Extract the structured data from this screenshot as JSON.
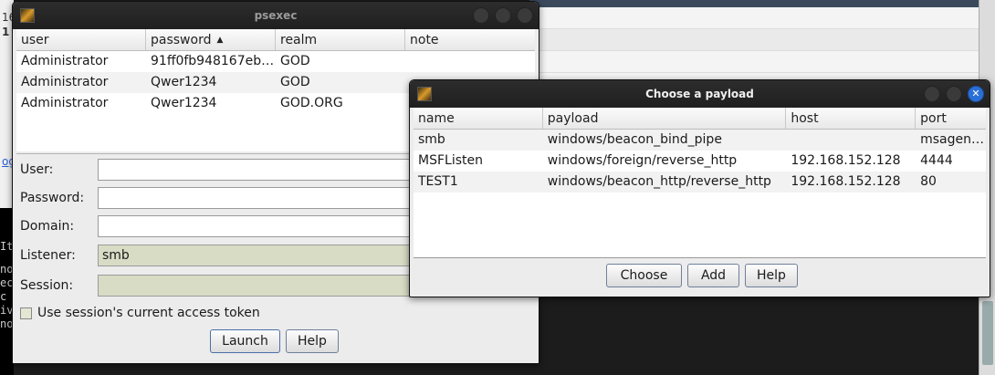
{
  "background": {
    "left_fragments": [
      "16",
      "1",
      "og"
    ],
    "terminal_lines": [
      "It",
      "",
      "no",
      "ec",
      "c",
      "iv",
      "no"
    ]
  },
  "psexec": {
    "title": "psexec",
    "columns": [
      "user",
      "password",
      "realm",
      "note"
    ],
    "sort_indicator": "▲",
    "rows": [
      [
        "Administrator",
        "91ff0fb948167eb…",
        "GOD",
        ""
      ],
      [
        "Administrator",
        "Qwer1234",
        "GOD",
        ""
      ],
      [
        "Administrator",
        "Qwer1234",
        "GOD.ORG",
        ""
      ]
    ],
    "form": {
      "user_label": "User:",
      "password_label": "Password:",
      "domain_label": "Domain:",
      "listener_label": "Listener:",
      "listener_value": "smb",
      "session_label": "Session:",
      "token_label": "Use session's current access token"
    },
    "buttons": {
      "launch": "Launch",
      "help": "Help"
    }
  },
  "payload": {
    "title": "Choose a payload",
    "columns": [
      "name",
      "payload",
      "host",
      "port"
    ],
    "rows": [
      [
        "smb",
        "windows/beacon_bind_pipe",
        "",
        "msagen…"
      ],
      [
        "MSFListen",
        "windows/foreign/reverse_http",
        "192.168.152.128",
        "4444"
      ],
      [
        "TEST1",
        "windows/beacon_http/reverse_http",
        "192.168.152.128",
        "80"
      ]
    ],
    "buttons": {
      "choose": "Choose",
      "add": "Add",
      "help": "Help"
    }
  }
}
